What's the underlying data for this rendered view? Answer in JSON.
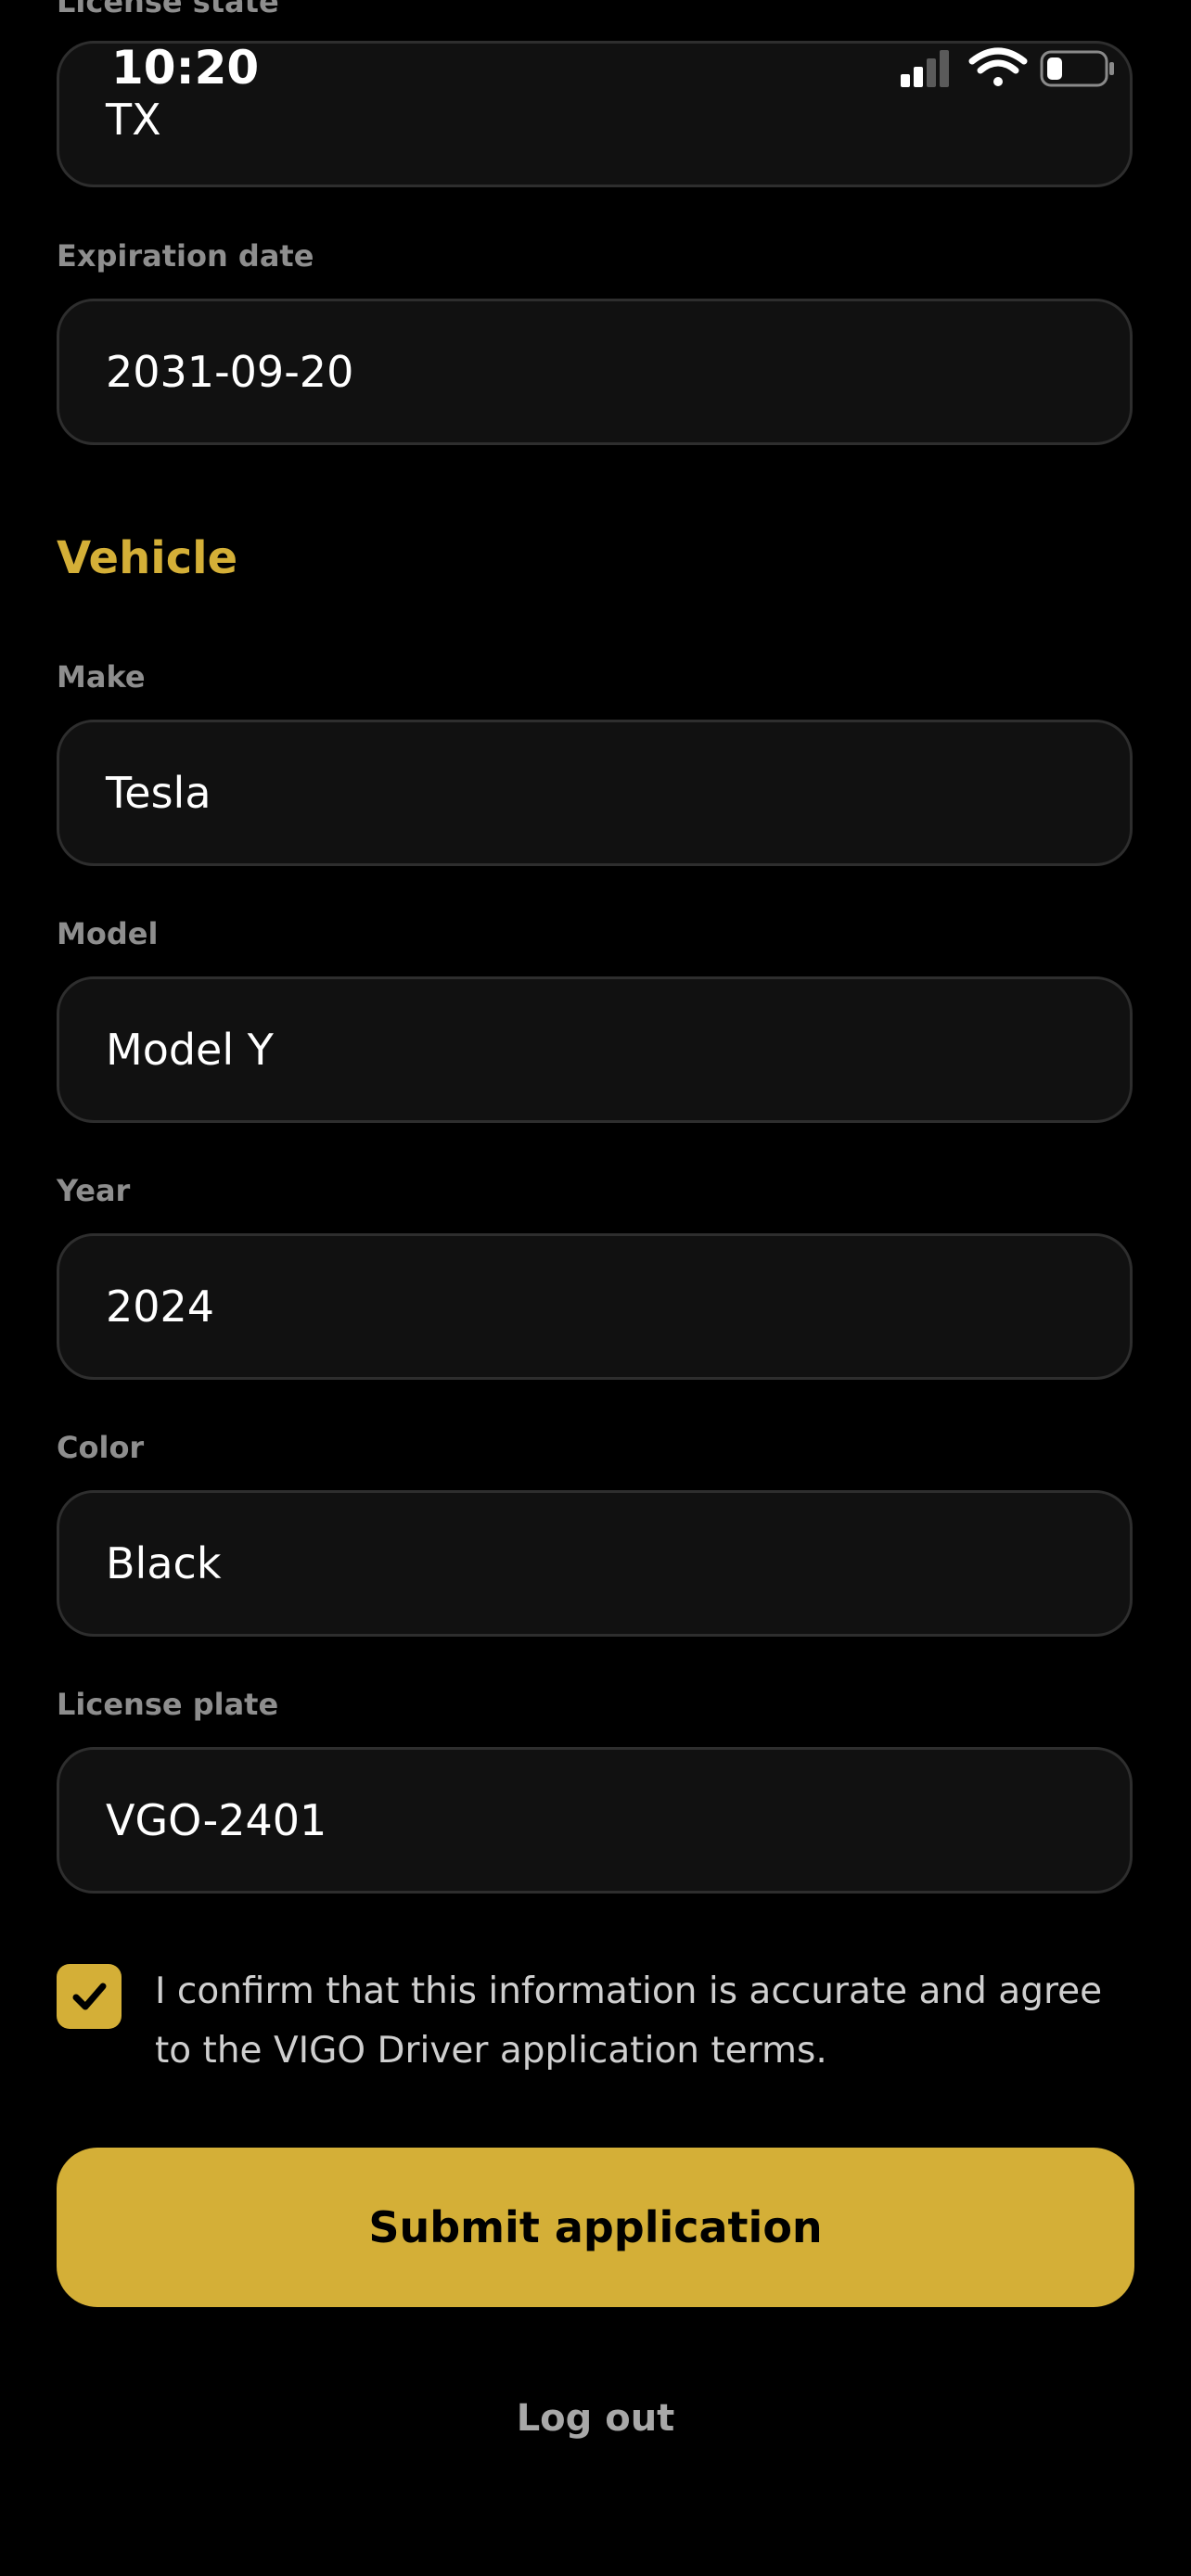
{
  "status_bar": {
    "time": "10:20"
  },
  "form": {
    "license_state": {
      "label": "License state",
      "value": "TX"
    },
    "expiration_date": {
      "label": "Expiration date",
      "value": "2031-09-20"
    },
    "vehicle_section_title": "Vehicle",
    "make": {
      "label": "Make",
      "value": "Tesla"
    },
    "model": {
      "label": "Model",
      "value": "Model Y"
    },
    "year": {
      "label": "Year",
      "value": "2024"
    },
    "color": {
      "label": "Color",
      "value": "Black"
    },
    "license_plate": {
      "label": "License plate",
      "value": "VGO-2401"
    },
    "consent_checked": true,
    "consent_text": "I confirm that this information is accurate and agree to the VIGO Driver application terms."
  },
  "actions": {
    "submit_label": "Submit application",
    "logout_label": "Log out"
  },
  "colors": {
    "accent": "#d4af37",
    "background": "#000000",
    "field_background": "#111111",
    "field_border": "#2e2e2e",
    "label": "#8e8e8e"
  },
  "icons": {
    "signal": "cellular-signal-icon",
    "wifi": "wifi-icon",
    "battery": "battery-icon",
    "check": "checkmark-icon"
  }
}
